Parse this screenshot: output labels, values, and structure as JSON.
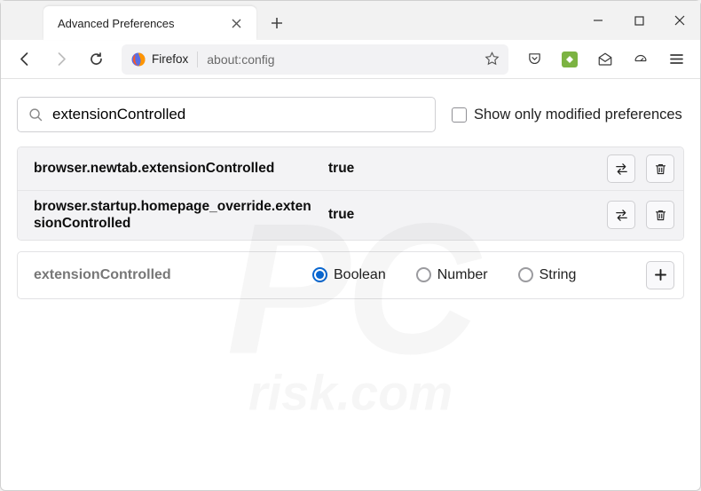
{
  "window": {
    "tab_title": "Advanced Preferences"
  },
  "toolbar": {
    "identity_label": "Firefox",
    "url": "about:config"
  },
  "page": {
    "search_value": "extensionControlled",
    "show_modified_label": "Show only modified preferences",
    "show_modified_checked": false,
    "prefs": [
      {
        "name": "browser.newtab.extensionControlled",
        "value": "true"
      },
      {
        "name": "browser.startup.homepage_override.extensionControlled",
        "value": "true"
      }
    ],
    "new_pref": {
      "name": "extensionControlled",
      "types": [
        "Boolean",
        "Number",
        "String"
      ],
      "selected": "Boolean"
    }
  },
  "watermark": {
    "big": "PC",
    "small": "risk.com"
  }
}
